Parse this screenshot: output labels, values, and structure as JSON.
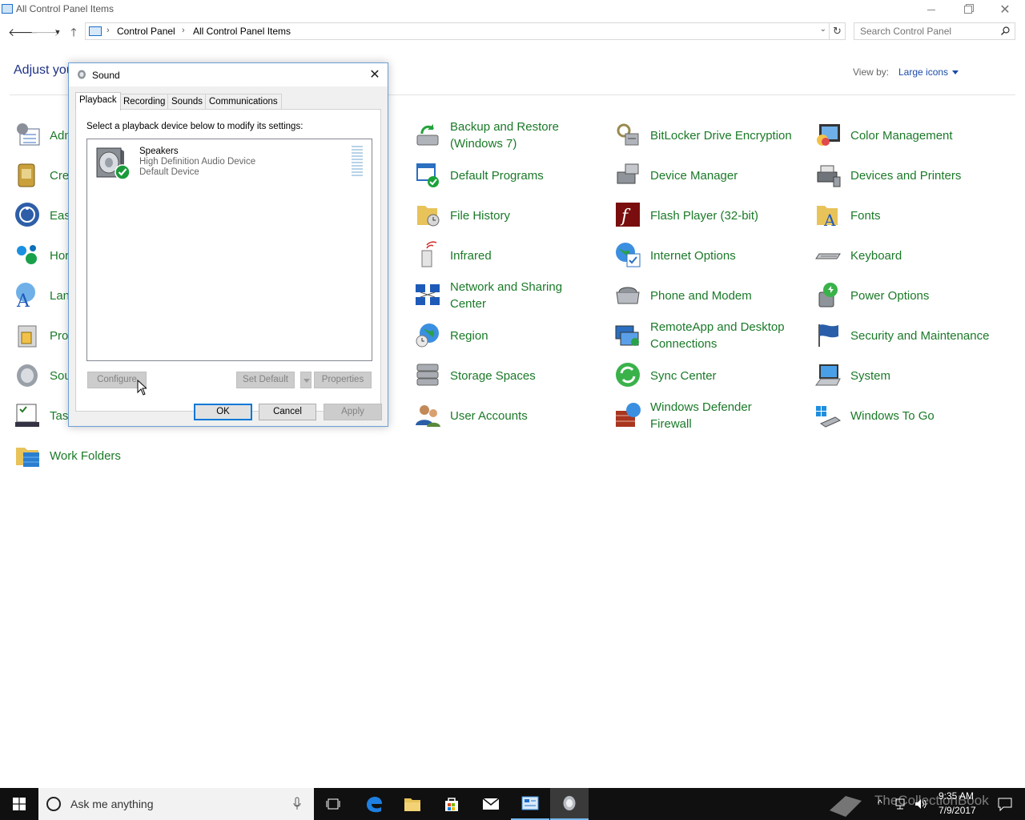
{
  "window": {
    "title": "All Control Panel Items"
  },
  "address": {
    "crumbs": [
      "Control Panel",
      "All Control Panel Items"
    ],
    "search_placeholder": "Search Control Panel"
  },
  "header": {
    "heading": "Adjust you",
    "view_by_label": "View by:",
    "view_by_value": "Large icons"
  },
  "items": {
    "col1": [
      "Adm",
      "Cre",
      "Eas",
      "Hor",
      "Lan",
      "Pro",
      "Sou",
      "Tas",
      "Work Folders"
    ],
    "col3": [
      "Backup and Restore (Windows 7)",
      "Default Programs",
      "File History",
      "Infrared",
      "Network and Sharing Center",
      "Region",
      "Storage Spaces",
      "User Accounts"
    ],
    "col4": [
      "BitLocker Drive Encryption",
      "Device Manager",
      "Flash Player (32-bit)",
      "Internet Options",
      "Phone and Modem",
      "RemoteApp and Desktop Connections",
      "Sync Center",
      "Windows Defender Firewall"
    ],
    "col5": [
      "Color Management",
      "Devices and Printers",
      "Fonts",
      "Keyboard",
      "Power Options",
      "Security and Maintenance",
      "System",
      "Windows To Go"
    ]
  },
  "dialog": {
    "title": "Sound",
    "tabs": [
      "Playback",
      "Recording",
      "Sounds",
      "Communications"
    ],
    "instruction": "Select a playback device below to modify its settings:",
    "device": {
      "name": "Speakers",
      "description": "High Definition Audio Device",
      "status": "Default Device"
    },
    "buttons": {
      "configure": "Configure",
      "set_default": "Set Default",
      "properties": "Properties",
      "ok": "OK",
      "cancel": "Cancel",
      "apply": "Apply"
    }
  },
  "taskbar": {
    "search_text": "Ask me anything",
    "time": "9:35 AM",
    "date": "7/9/2017",
    "watermark": "TheCollectionBook"
  },
  "colors": {
    "link_green": "#1a7a28",
    "heading_blue": "#1e3287",
    "accent": "#0078d7"
  }
}
